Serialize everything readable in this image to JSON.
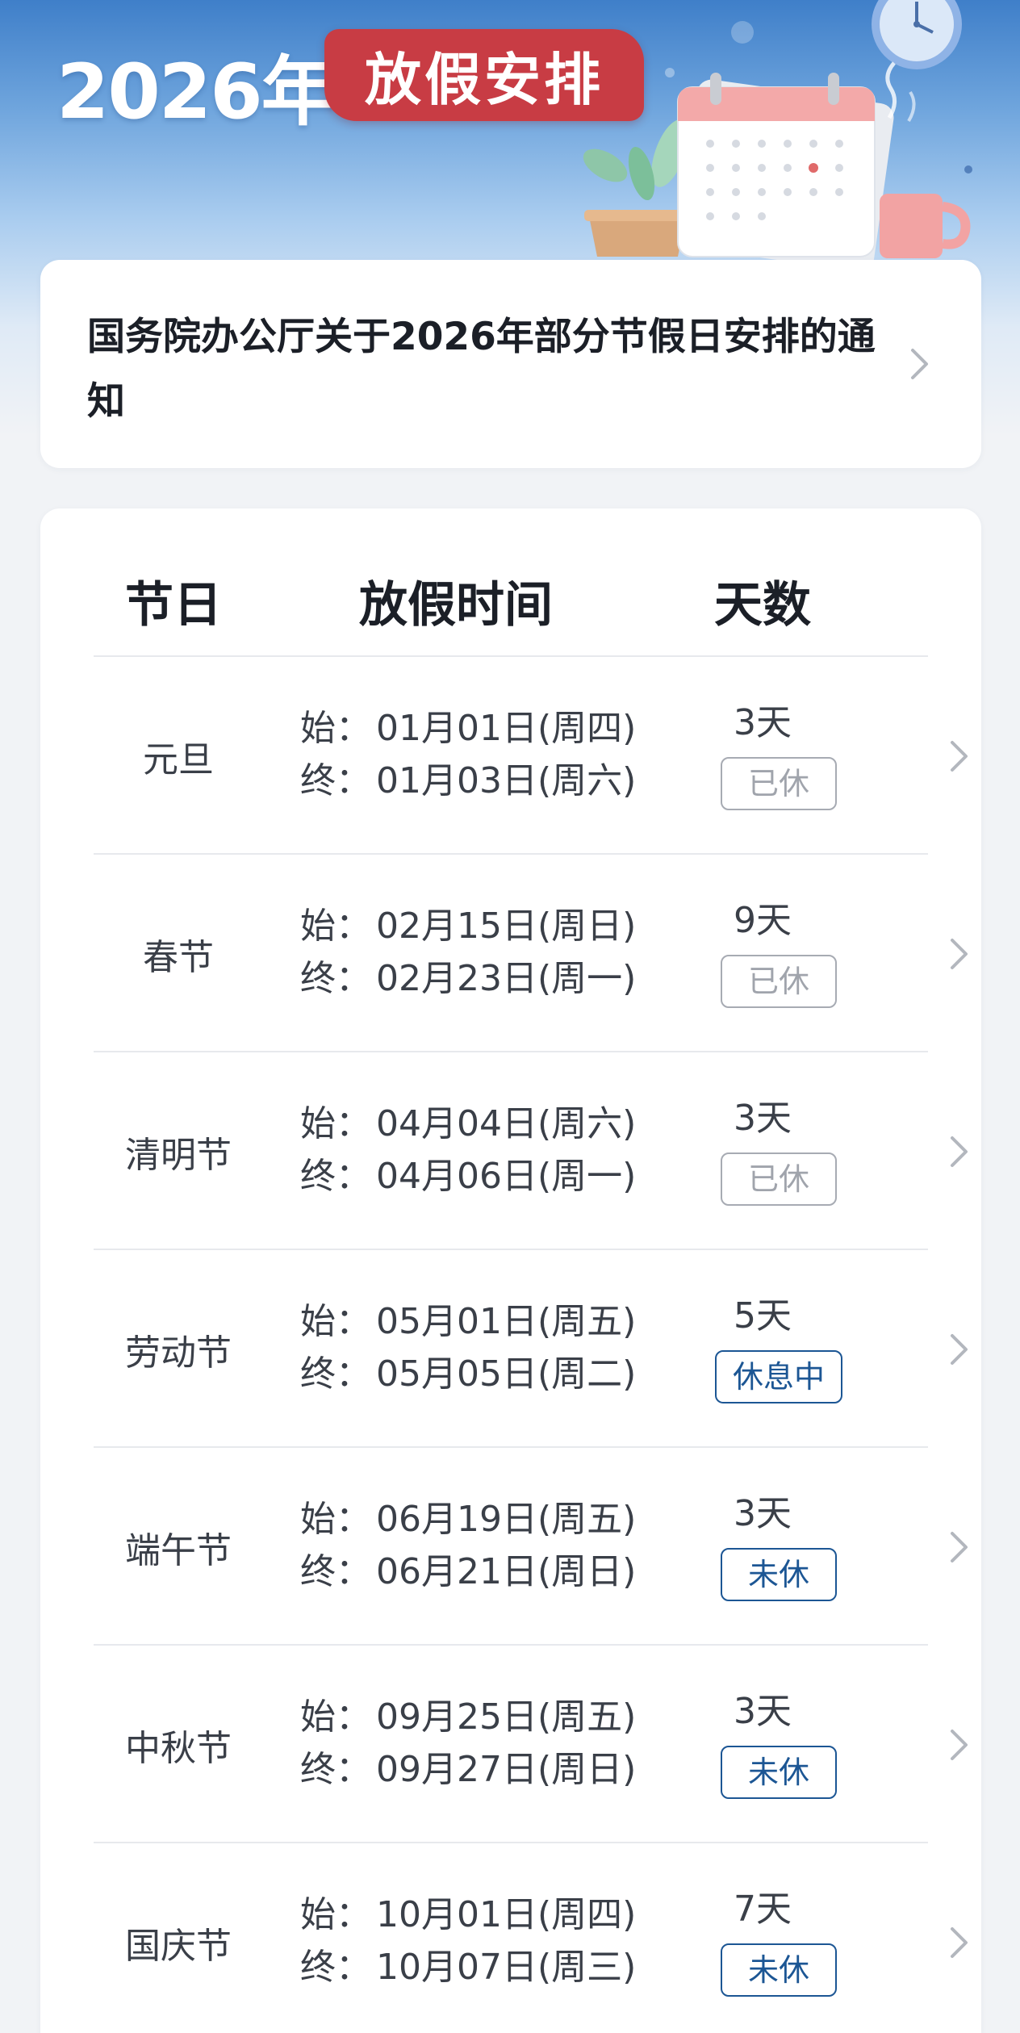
{
  "hero": {
    "year": "2026年",
    "tag": "放假安排"
  },
  "notice": {
    "title": "国务院办公厅关于2026年部分节假日安排的通知"
  },
  "table": {
    "headers": [
      "节日",
      "放假时间",
      "天数"
    ],
    "start_label": "始：",
    "end_label": "终：",
    "rows": [
      {
        "name": "元旦",
        "start": "01月01日(周四)",
        "end": "01月03日(周六)",
        "days": "3天",
        "status": "已休",
        "status_type": "done"
      },
      {
        "name": "春节",
        "start": "02月15日(周日)",
        "end": "02月23日(周一)",
        "days": "9天",
        "status": "已休",
        "status_type": "done"
      },
      {
        "name": "清明节",
        "start": "04月04日(周六)",
        "end": "04月06日(周一)",
        "days": "3天",
        "status": "已休",
        "status_type": "done"
      },
      {
        "name": "劳动节",
        "start": "05月01日(周五)",
        "end": "05月05日(周二)",
        "days": "5天",
        "status": "休息中",
        "status_type": "active"
      },
      {
        "name": "端午节",
        "start": "06月19日(周五)",
        "end": "06月21日(周日)",
        "days": "3天",
        "status": "未休",
        "status_type": "todo"
      },
      {
        "name": "中秋节",
        "start": "09月25日(周五)",
        "end": "09月27日(周日)",
        "days": "3天",
        "status": "未休",
        "status_type": "todo"
      },
      {
        "name": "国庆节",
        "start": "10月01日(周四)",
        "end": "10月07日(周三)",
        "days": "7天",
        "status": "未休",
        "status_type": "todo"
      }
    ]
  },
  "colors": {
    "hero_blue": "#3f7fc9",
    "tag_red": "#c83c44",
    "status_blue": "#1c5694",
    "status_gray": "#a0a4ac"
  },
  "icons": [
    "clock-icon",
    "calendar-icon",
    "plant-icon",
    "mug-icon",
    "chevron-right-icon"
  ]
}
